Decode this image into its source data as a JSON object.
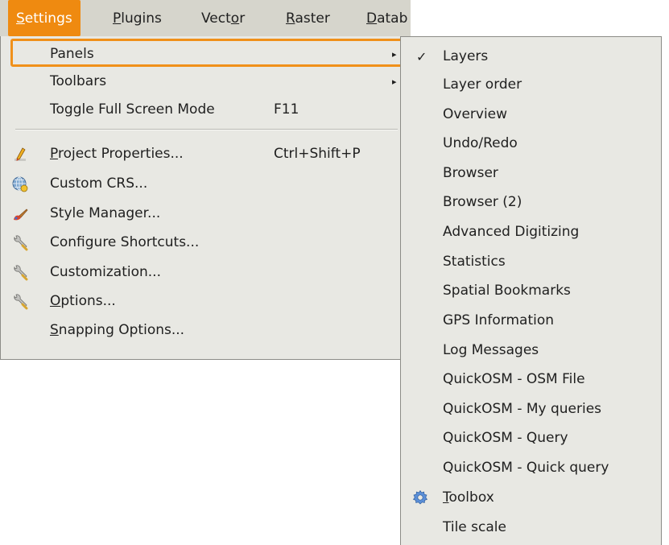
{
  "menubar": {
    "items": [
      {
        "label": "Settings",
        "mnemonic": "S",
        "rest": "ettings",
        "active": true
      },
      {
        "label": "Plugins",
        "mnemonic": "P",
        "rest": "lugins"
      },
      {
        "label": "Vector",
        "pre": "Vect",
        "mnemonic": "o",
        "rest": "r"
      },
      {
        "label": "Raster",
        "mnemonic": "R",
        "rest": "aster"
      },
      {
        "label": "Datab",
        "mnemonic": "D",
        "rest": "atab"
      }
    ]
  },
  "settings_menu": {
    "panels": "Panels",
    "toolbars": "Toolbars",
    "toggle_full_screen": "Toggle Full Screen Mode",
    "toggle_full_screen_shortcut": "F11",
    "project_properties_mn": "P",
    "project_properties_rest": "roject Properties...",
    "project_properties_shortcut": "Ctrl+Shift+P",
    "custom_crs": "Custom CRS...",
    "style_manager": "Style Manager...",
    "configure_shortcuts": "Configure Shortcuts...",
    "customization": "Customization...",
    "options_mn": "O",
    "options_rest": "ptions...",
    "snapping_options_mn": "S",
    "snapping_options_rest": "napping Options..."
  },
  "panels_submenu": {
    "check_glyph": "✓",
    "items": [
      {
        "label": "Layers",
        "checked": true
      },
      {
        "label": "Layer order"
      },
      {
        "label": "Overview"
      },
      {
        "label": "Undo/Redo"
      },
      {
        "label": "Browser"
      },
      {
        "label": "Browser (2)"
      },
      {
        "label": "Advanced Digitizing"
      },
      {
        "label": "Statistics"
      },
      {
        "label": "Spatial Bookmarks"
      },
      {
        "label": "GPS Information"
      },
      {
        "label": "Log Messages"
      },
      {
        "label": "QuickOSM - OSM File"
      },
      {
        "label": "QuickOSM - My queries"
      },
      {
        "label": "QuickOSM - Query"
      },
      {
        "label": "QuickOSM - Quick query"
      },
      {
        "label": "Toolbox",
        "mnemonic": "T",
        "rest": "oolbox",
        "icon": "gear-icon"
      },
      {
        "label": "Tile scale"
      }
    ]
  },
  "colors": {
    "accent": "#ef8a10",
    "menu_bg": "#e8e8e3",
    "menubar_bg": "#d6d5cc"
  },
  "icons": {
    "submenu_arrow": "▸",
    "project_properties": "pencil-icon",
    "custom_crs": "globe-icon",
    "style_manager": "brush-icon",
    "configure_shortcuts": "wrench-icon",
    "customization": "wrench-icon",
    "options": "wrench-icon",
    "toolbox": "gear-icon"
  }
}
